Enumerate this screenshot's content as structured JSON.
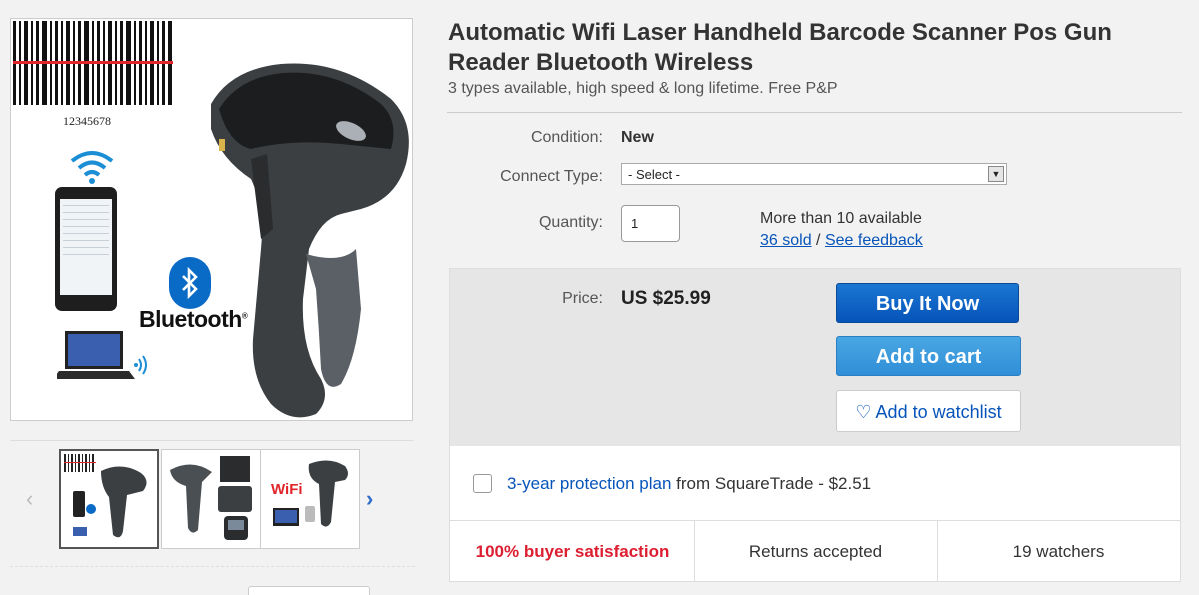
{
  "product": {
    "title": "Automatic Wifi Laser Handheld Barcode Scanner Pos Gun Reader Bluetooth Wireless",
    "subtitle": "3 types available, high speed & long lifetime. Free P&P"
  },
  "image": {
    "barcode_number": "12345678",
    "bluetooth_word": "Bluetooth",
    "thumb_wifi_word": "WiFi"
  },
  "details": {
    "condition_label": "Condition:",
    "condition_value": "New",
    "connect_type_label": "Connect Type:",
    "connect_type_selected": "- Select -",
    "quantity_label": "Quantity:",
    "quantity_value": "1",
    "availability": "More than 10 available",
    "sold_link": "36 sold",
    "separator": "/",
    "feedback_link": "See feedback"
  },
  "purchase": {
    "price_label": "Price:",
    "price_value": "US $25.99",
    "buy_now": "Buy It Now",
    "add_to_cart": "Add to cart",
    "watchlist": "Add to watchlist"
  },
  "protection": {
    "plan_link": "3-year protection plan",
    "plan_text": "from SquareTrade - $2.51"
  },
  "stats": {
    "satisfaction": "100% buyer satisfaction",
    "returns": "Returns accepted",
    "watchers": "19 watchers"
  },
  "icons": {
    "prev": "chevron-left-icon",
    "next": "chevron-right-icon",
    "heart": "heart-icon",
    "dropdown": "chevron-down-icon"
  },
  "colors": {
    "link": "#0654ba",
    "buy_button": "#0654ba",
    "cart_button": "#3a9ade",
    "satisfaction": "#dd1e31"
  }
}
